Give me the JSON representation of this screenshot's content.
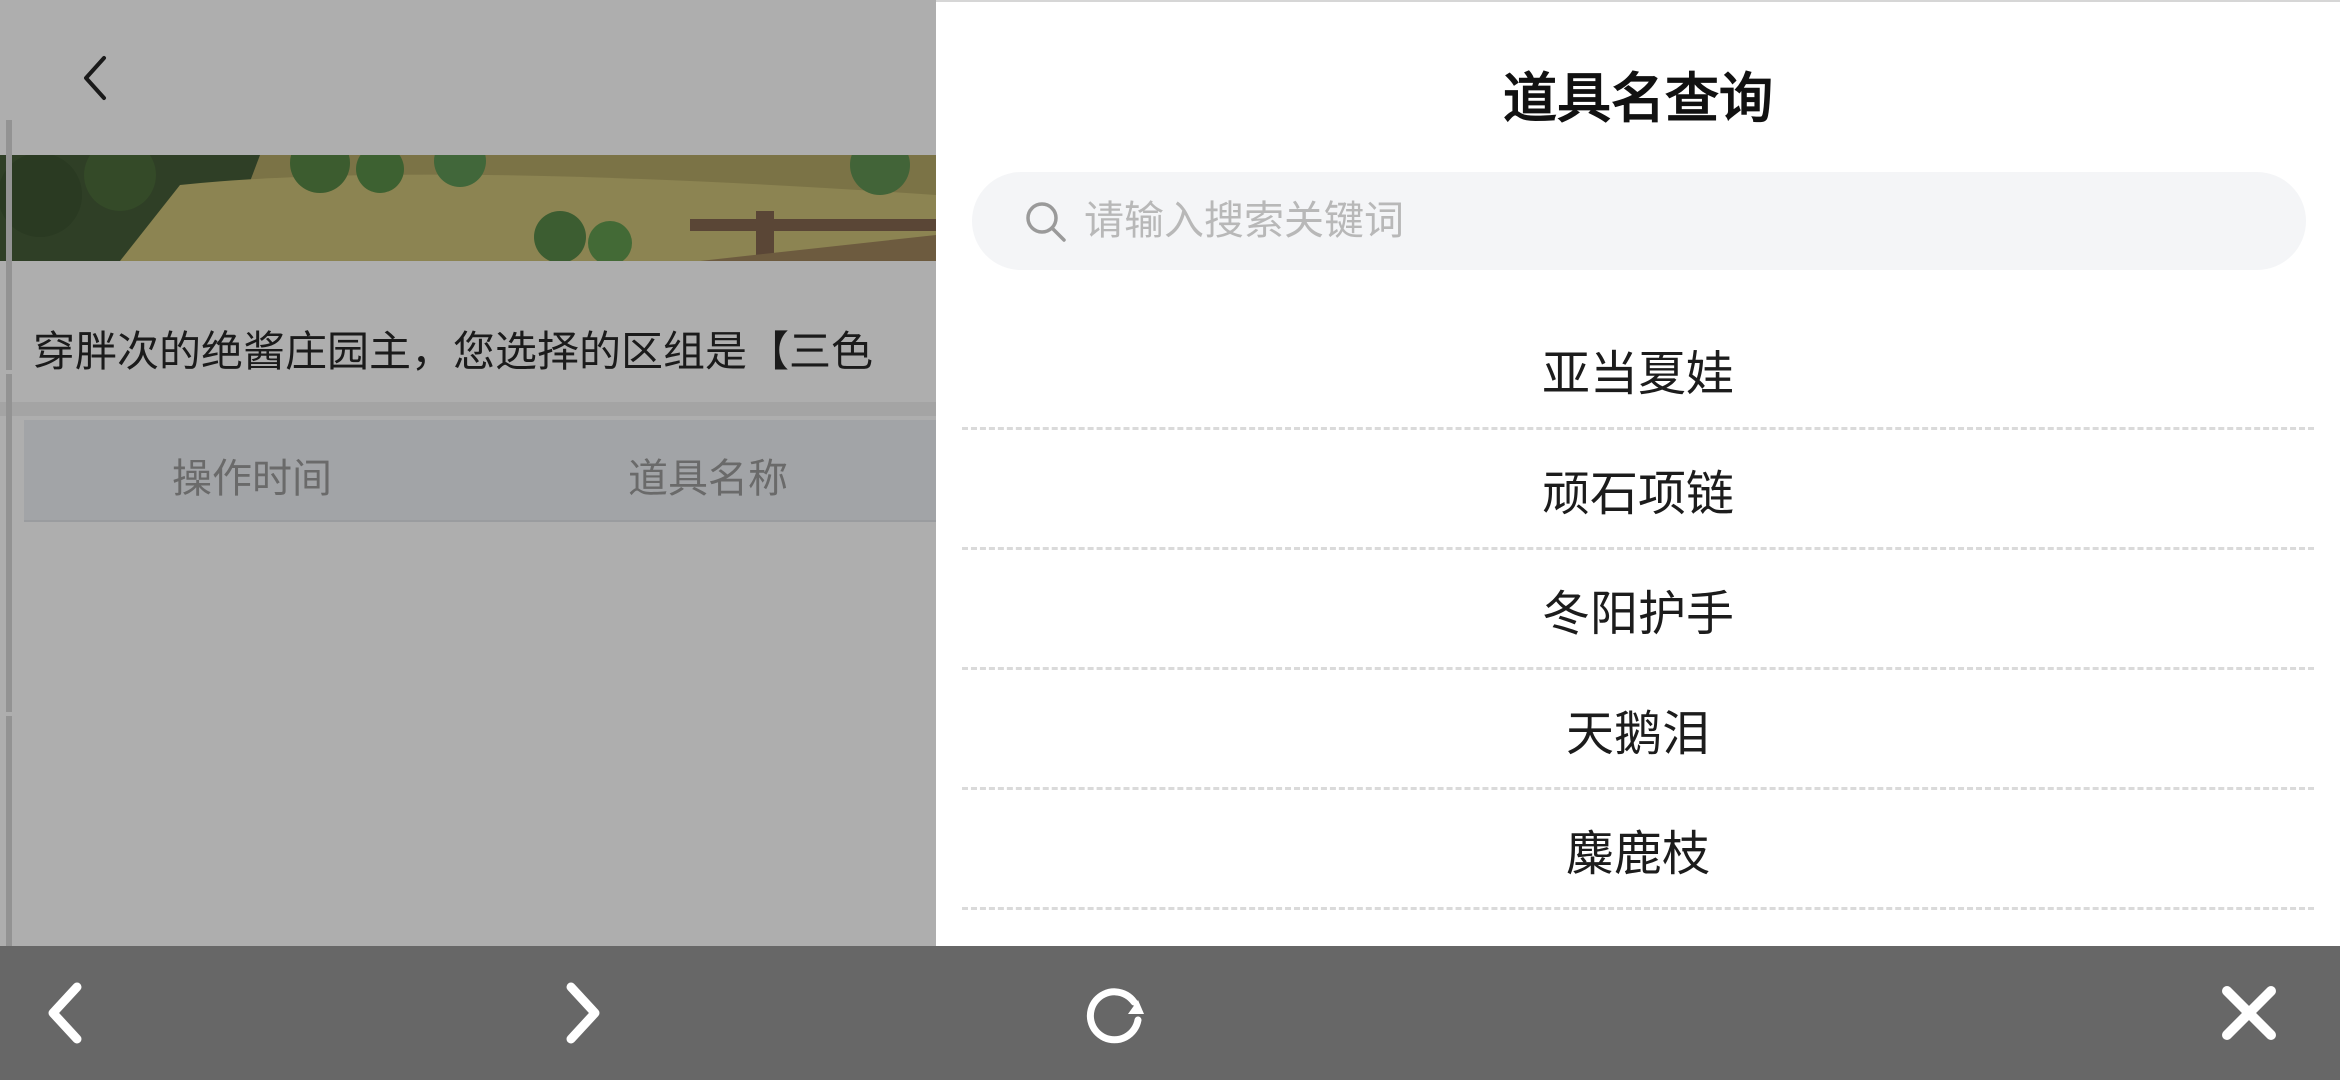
{
  "background_page": {
    "notice_text": "穿胖次的绝酱庄园主，您选择的区组是【三色",
    "table_headers": [
      "操作时间",
      "道具名称"
    ]
  },
  "drawer": {
    "title": "道具名查询",
    "search": {
      "placeholder": "请输入搜索关键词",
      "value": ""
    },
    "results": [
      "亚当夏娃",
      "顽石项链",
      "冬阳护手",
      "天鹅泪",
      "麋鹿枝"
    ]
  },
  "toolbar": {
    "icons": [
      "chevron-left-icon",
      "chevron-right-icon",
      "refresh-icon",
      "close-icon"
    ]
  },
  "colors": {
    "overlay_bg": "#aeaeae",
    "drawer_bg": "#ffffff",
    "toolbar_bg": "#676767",
    "search_bg": "#f4f5f7"
  }
}
